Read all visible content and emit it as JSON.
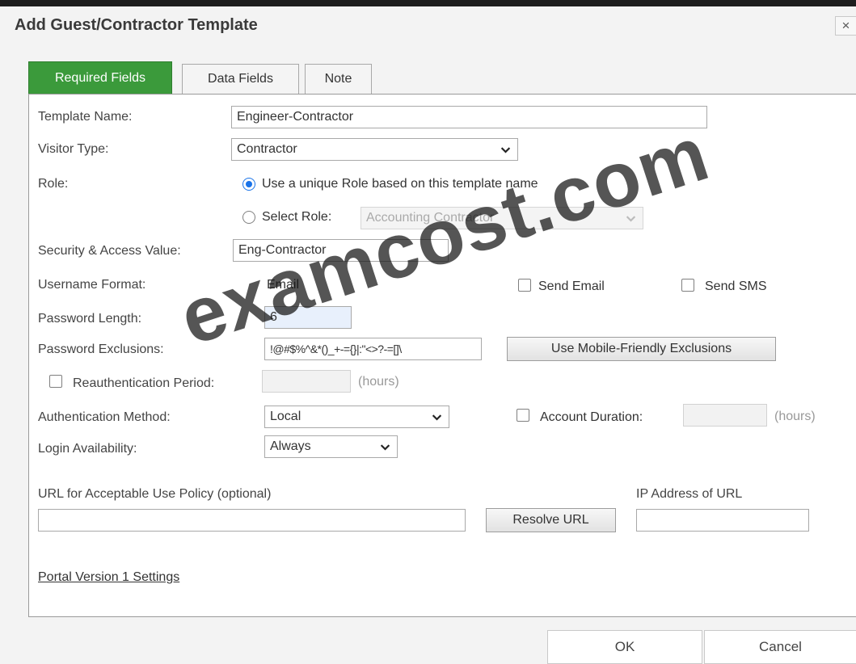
{
  "dialog": {
    "title": "Add Guest/Contractor Template",
    "close_label": "×"
  },
  "tabs": [
    {
      "label": "Required Fields",
      "active": true
    },
    {
      "label": "Data Fields",
      "active": false
    },
    {
      "label": "Note",
      "active": false
    }
  ],
  "form": {
    "template_name": {
      "label": "Template Name:",
      "value": "Engineer-Contractor"
    },
    "visitor_type": {
      "label": "Visitor Type:",
      "value": "Contractor"
    },
    "role": {
      "label": "Role:",
      "option_unique": "Use a unique Role based on this template name",
      "option_select": "Select Role:",
      "select_value": "Accounting Contractor",
      "selected": "unique"
    },
    "security_access": {
      "label": "Security & Access Value:",
      "value": "Eng-Contractor"
    },
    "username_format": {
      "label": "Username Format:",
      "value": "Email"
    },
    "send_email": {
      "label": "Send Email",
      "checked": false
    },
    "send_sms": {
      "label": "Send SMS",
      "checked": false
    },
    "password_length": {
      "label": "Password Length:",
      "value": "6"
    },
    "password_exclusions": {
      "label": "Password Exclusions:",
      "value": "!@#$%^&*()_+-={}|:\"<>?-=[]\\",
      "button": "Use Mobile-Friendly Exclusions"
    },
    "reauth": {
      "label": "Reauthentication Period:",
      "checked": false,
      "value": "",
      "unit": "(hours)"
    },
    "auth_method": {
      "label": "Authentication Method:",
      "value": "Local"
    },
    "account_duration": {
      "label": "Account Duration:",
      "checked": false,
      "value": "",
      "unit": "(hours)"
    },
    "login_availability": {
      "label": "Login Availability:",
      "value": "Always"
    },
    "aup_url": {
      "label": "URL for Acceptable Use Policy (optional)",
      "value": "",
      "button": "Resolve URL"
    },
    "ip_address": {
      "label": "IP Address of URL",
      "value": ""
    },
    "portal_link": "Portal Version 1 Settings"
  },
  "footer": {
    "ok_label": "OK",
    "cancel_label": "Cancel"
  },
  "watermark": "examcost.com",
  "colors": {
    "active_tab": "#3b9a3b",
    "radio_accent": "#1a73e8",
    "input_highlight": "#e8f0fc"
  }
}
